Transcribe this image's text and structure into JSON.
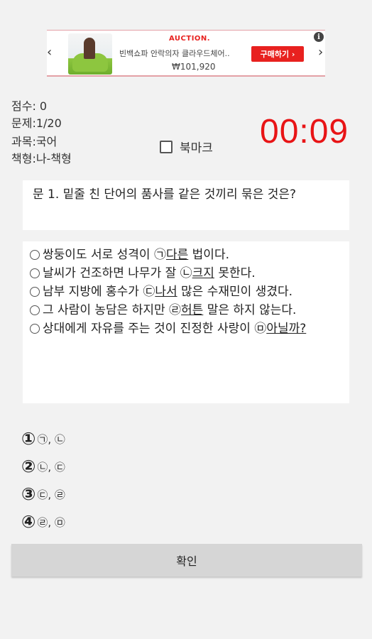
{
  "ad": {
    "brand": "AUCTION.",
    "title": "빈백쇼파 안락의자 클라우드체어..",
    "price": "₩101,920",
    "buy_label": "구매하기 ›",
    "info": "i",
    "prev": "‹",
    "next": "›"
  },
  "info": {
    "score": "점수: 0",
    "problem": "문제:1/20",
    "subject": "과목:국어",
    "booklet": "책형:나-책형"
  },
  "timer": "00:09",
  "bookmark_label": "북마크",
  "question": "문 1. 밑줄 친 단어의 품사를 같은 것끼리 묶은 것은?",
  "passages": [
    {
      "pre": "쌍둥이도 서로 성격이 ㉠",
      "u": "다른",
      "post": " 법이다."
    },
    {
      "pre": "날씨가 건조하면 나무가 잘 ㉡",
      "u": "크지",
      "post": " 못한다."
    },
    {
      "pre": "남부 지방에 홍수가 ㉢",
      "u": "나서",
      "post": " 많은 수재민이 생겼다."
    },
    {
      "pre": "그 사람이 농담은 하지만 ㉣",
      "u": "허튼",
      "post": " 말은 하지 않는다."
    },
    {
      "pre": "상대에게 자유를 주는 것이 진정한 사랑이 ㉤",
      "u": "아닐까?",
      "post": ""
    }
  ],
  "answers": [
    {
      "num": "①",
      "text": "㉠, ㉡"
    },
    {
      "num": "②",
      "text": "㉡, ㉢"
    },
    {
      "num": "③",
      "text": "㉢, ㉣"
    },
    {
      "num": "④",
      "text": "㉣, ㉤"
    }
  ],
  "confirm_label": "확인"
}
